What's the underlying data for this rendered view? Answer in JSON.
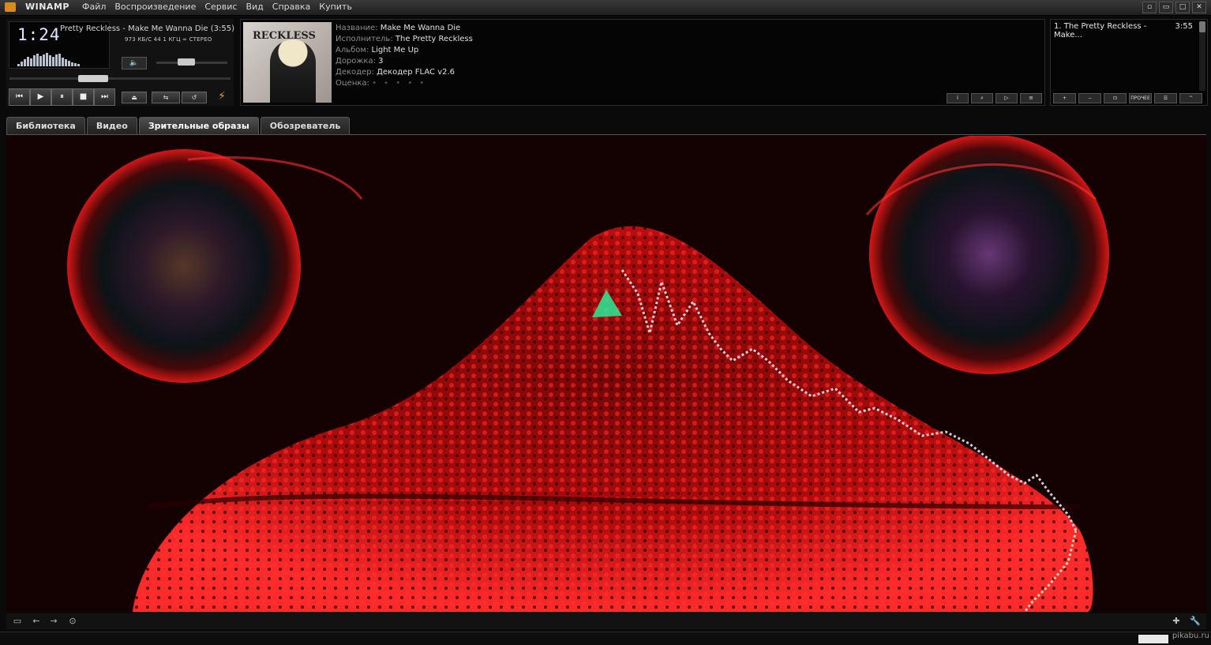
{
  "window": {
    "app_name": "WINAMP"
  },
  "menu": [
    "Файл",
    "Воспроизведение",
    "Сервис",
    "Вид",
    "Справка",
    "Купить"
  ],
  "window_controls": [
    "▫",
    "▭",
    "□",
    "✕"
  ],
  "player": {
    "time": "1:24",
    "song_title": "Pretty Reckless - Make Me Wanna Die (3:55)",
    "bitrate_line": "973 КБ/С   44   1 КГЦ     ∞ СТЕРЕО",
    "volume_level": 0.4,
    "seek_position": 0.36,
    "controls": [
      "⏮",
      "▶",
      "⏸",
      "■",
      "⏭"
    ],
    "eject_label": "⏏",
    "toggle_labels": [
      "⇆",
      "↺"
    ],
    "volume_icon": "🔈"
  },
  "track_info": {
    "title_label": "Название:",
    "title": "Make Me Wanna Die",
    "artist_label": "Исполнитель:",
    "artist": "The Pretty Reckless",
    "album_label": "Альбом:",
    "album": "Light Me Up",
    "track_label": "Дорожка:",
    "track": "3",
    "decoder_label": "Декодер:",
    "decoder": "Декодер FLAC v2.6",
    "rating_label": "Оценка:",
    "rating": "• • • • •",
    "cover_text": "RECKLESS",
    "buttons": [
      "i",
      "⌕",
      "▷",
      "≡"
    ]
  },
  "playlist": {
    "items": [
      {
        "label": "1. The Pretty Reckless - Make...",
        "duration": "3:55"
      }
    ],
    "buttons": [
      "+",
      "−",
      "⊡",
      "ПРОЧЕЕ",
      "☰",
      "^"
    ]
  },
  "tabs": [
    "Библиотека",
    "Видео",
    "Зрительные образы",
    "Обозреватель"
  ],
  "active_tab": "Зрительные образы",
  "bottom_icons": [
    "▭",
    "←",
    "→",
    "⊙"
  ],
  "bottom_right_icons": [
    "✚",
    "🔧"
  ],
  "watermark": "pikabu.ru",
  "colors": {
    "viz_red": "#e01010",
    "viz_dark": "#120202",
    "accent_orange": "#d98a1c"
  }
}
